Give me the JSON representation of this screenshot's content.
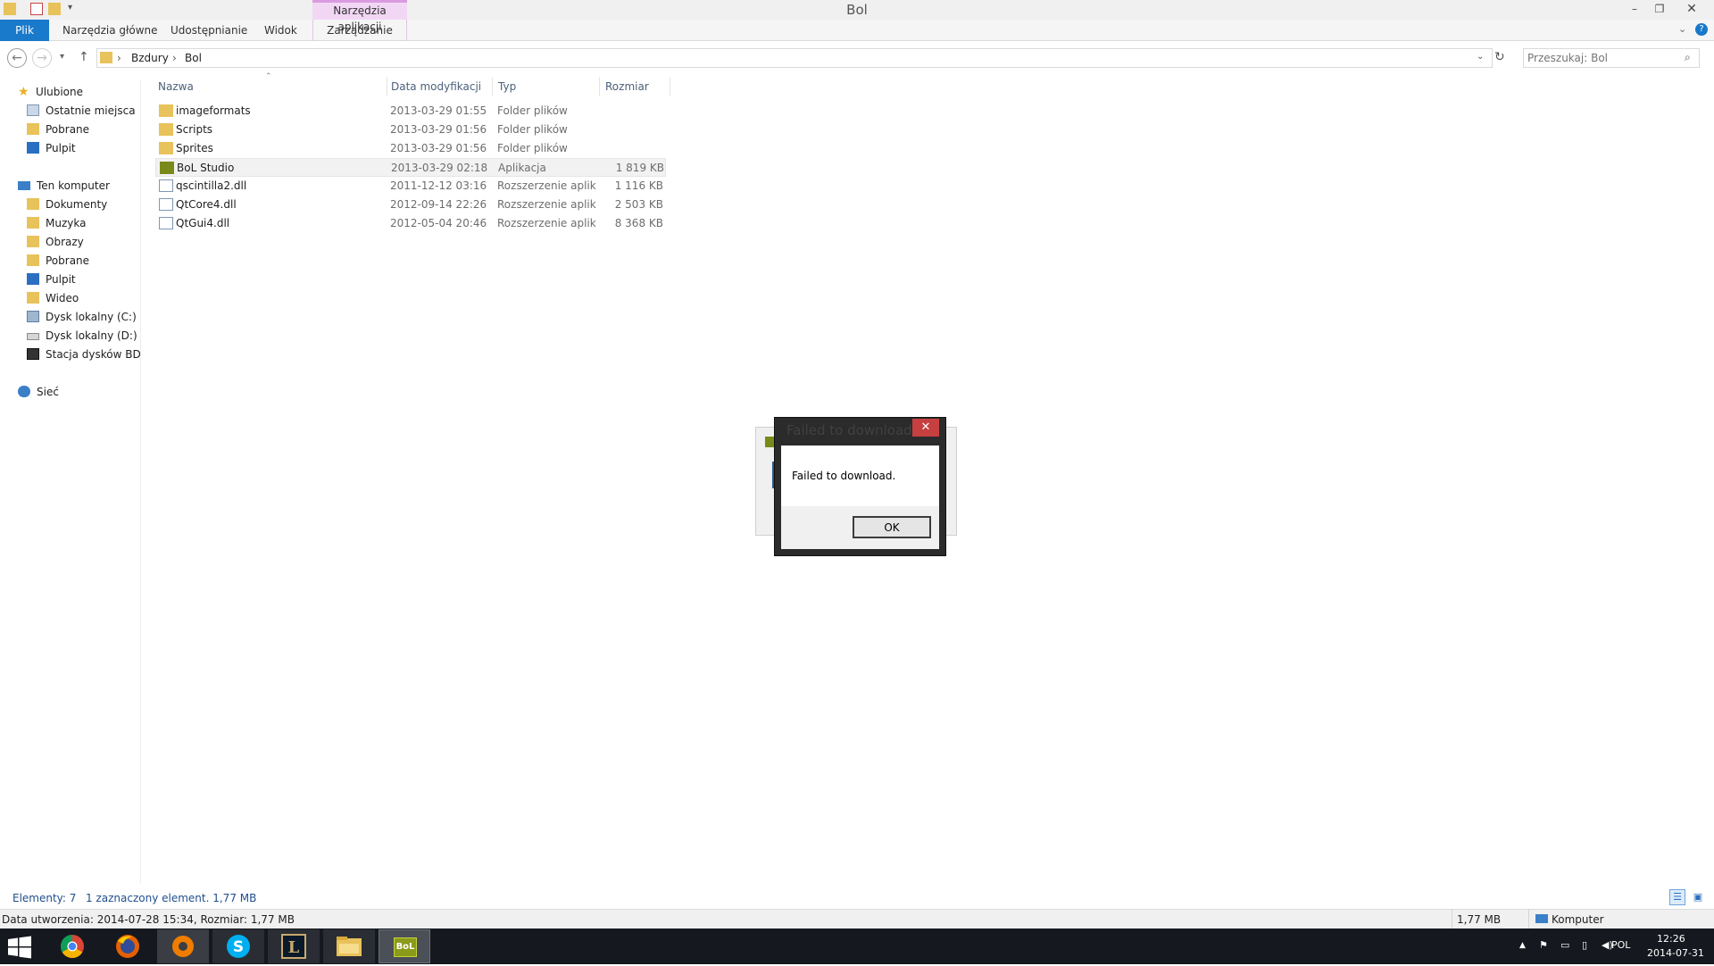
{
  "window": {
    "title": "Bol"
  },
  "ribbon": {
    "tabs": [
      "Plik",
      "Narzędzia główne",
      "Udostępnianie",
      "Widok"
    ],
    "contextual_header": "Narzędzia aplikacji",
    "contextual_tab": "Zarządzanie"
  },
  "address": {
    "segments": [
      "Bzdury",
      "Bol"
    ],
    "search_placeholder": "Przeszukaj: Bol"
  },
  "nav_pane": {
    "favorites_header": "Ulubione",
    "favorites": [
      "Ostatnie miejsca",
      "Pobrane",
      "Pulpit"
    ],
    "computer_header": "Ten komputer",
    "computer_items": [
      "Dokumenty",
      "Muzyka",
      "Obrazy",
      "Pobrane",
      "Pulpit",
      "Wideo",
      "Dysk lokalny (C:)",
      "Dysk lokalny (D:)",
      "Stacja dysków BD-R"
    ],
    "network": "Sieć"
  },
  "file_list": {
    "columns": [
      "Nazwa",
      "Data modyfikacji",
      "Typ",
      "Rozmiar"
    ],
    "rows": [
      {
        "name": "imageformats",
        "date": "2013-03-29 01:55",
        "type": "Folder plików",
        "size": "",
        "kind": "folder"
      },
      {
        "name": "Scripts",
        "date": "2013-03-29 01:56",
        "type": "Folder plików",
        "size": "",
        "kind": "folder"
      },
      {
        "name": "Sprites",
        "date": "2013-03-29 01:56",
        "type": "Folder plików",
        "size": "",
        "kind": "folder"
      },
      {
        "name": "BoL Studio",
        "date": "2013-03-29 02:18",
        "type": "Aplikacja",
        "size": "1 819 KB",
        "kind": "app"
      },
      {
        "name": "qscintilla2.dll",
        "date": "2011-12-12 03:16",
        "type": "Rozszerzenie aplik...",
        "size": "1 116 KB",
        "kind": "dll"
      },
      {
        "name": "QtCore4.dll",
        "date": "2012-09-14 22:26",
        "type": "Rozszerzenie aplik...",
        "size": "2 503 KB",
        "kind": "dll"
      },
      {
        "name": "QtGui4.dll",
        "date": "2012-05-04 20:46",
        "type": "Rozszerzenie aplik...",
        "size": "8 368 KB",
        "kind": "dll"
      }
    ],
    "selected_index": 3
  },
  "status": {
    "count": "Elementy: 7",
    "selection": "1 zaznaczony element. 1,77 MB",
    "details": "Data utworzenia: 2014-07-28 15:34, Rozmiar: 1,77 MB",
    "size": "1,77 MB",
    "location": "Komputer"
  },
  "dialog": {
    "title": "Failed to download.",
    "message": "Failed to download.",
    "ok_label": "OK"
  },
  "taskbar": {
    "apps": [
      "start-icon",
      "chrome-icon",
      "firefox-icon",
      "avast-icon",
      "skype-icon",
      "league-icon",
      "explorer-icon",
      "bol-icon"
    ],
    "bol_label": "BoL",
    "lang": "POL",
    "time": "12:26",
    "date": "2014-07-31"
  },
  "colors": {
    "accent": "#1979ca",
    "context_tab": "#f2d7f5",
    "dialog_close": "#c74040"
  }
}
